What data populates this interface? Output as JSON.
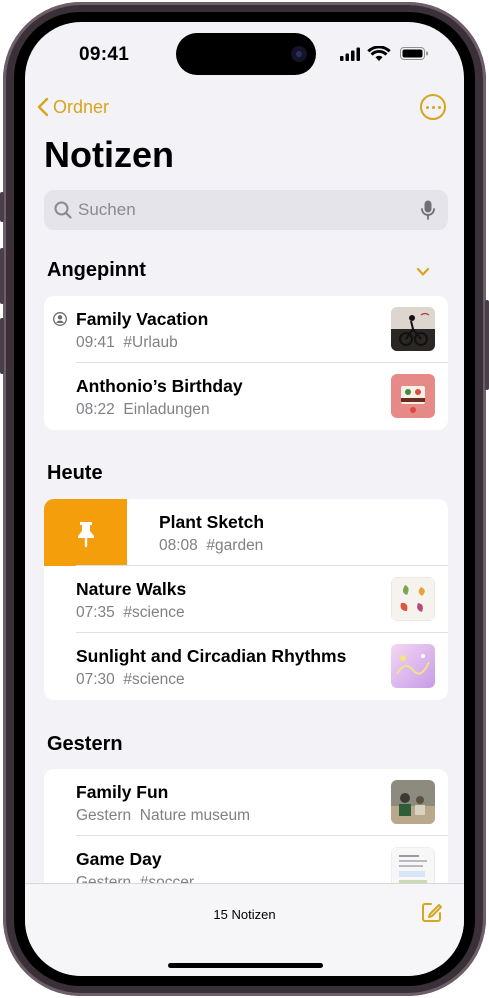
{
  "status": {
    "time": "09:41"
  },
  "nav": {
    "back_label": "Ordner"
  },
  "page": {
    "title": "Notizen"
  },
  "search": {
    "placeholder": "Suchen"
  },
  "sections": {
    "pinned": {
      "title": "Angepinnt",
      "items": [
        {
          "title": "Family Vacation",
          "time": "09:41",
          "detail": "#Urlaub",
          "shared": true
        },
        {
          "title": "Anthonio’s Birthday",
          "time": "08:22",
          "detail": "Einladungen"
        }
      ]
    },
    "today": {
      "title": "Heute",
      "items": [
        {
          "title": "Plant Sketch",
          "time": "08:08",
          "detail": "#garden",
          "swipe_action": "pin-icon"
        },
        {
          "title": "Nature Walks",
          "time": "07:35",
          "detail": "#science"
        },
        {
          "title": "Sunlight and Circadian Rhythms",
          "time": "07:30",
          "detail": "#science"
        }
      ]
    },
    "yesterday": {
      "title": "Gestern",
      "items": [
        {
          "title": "Family Fun",
          "time": "Gestern",
          "detail": "Nature museum"
        },
        {
          "title": "Game Day",
          "time": "Gestern",
          "detail": "#soccer"
        }
      ]
    }
  },
  "toolbar": {
    "count_label": "15 Notizen"
  },
  "colors": {
    "accent": "#d6a61c",
    "pin_action": "#f59e0b",
    "background": "#f2f2f7"
  }
}
